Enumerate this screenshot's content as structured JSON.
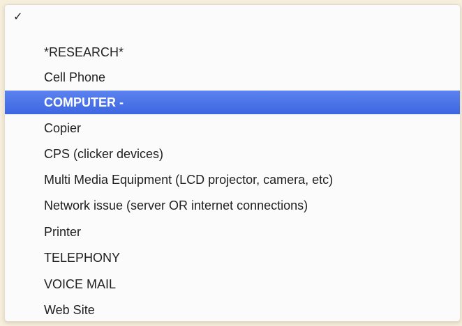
{
  "menu": {
    "check_glyph": "✓",
    "items": [
      {
        "label": "",
        "checked": true
      },
      {
        "label": "*RESEARCH*"
      },
      {
        "label": "Cell Phone"
      },
      {
        "label": "COMPUTER -",
        "highlighted": true
      },
      {
        "label": "Copier"
      },
      {
        "label": "CPS (clicker devices)"
      },
      {
        "label": "Multi Media Equipment (LCD projector, camera, etc)"
      },
      {
        "label": "Network issue (server OR internet connections)"
      },
      {
        "label": "Printer"
      },
      {
        "label": "TELEPHONY"
      },
      {
        "label": "VOICE MAIL"
      },
      {
        "label": "Web Site"
      }
    ],
    "highlight_color": "#3d67e2"
  }
}
